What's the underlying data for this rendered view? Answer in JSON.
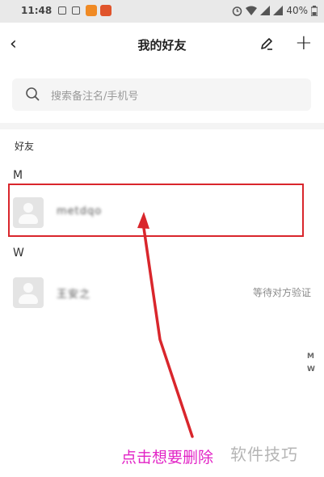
{
  "status_bar": {
    "time": "11:48",
    "battery": "40%"
  },
  "nav": {
    "title": "我的好友"
  },
  "search": {
    "placeholder": "搜索备注名/手机号"
  },
  "section_label": "好友",
  "groups": [
    {
      "letter": "M",
      "friends": [
        {
          "name": "metdqo",
          "status": ""
        }
      ]
    },
    {
      "letter": "W",
      "friends": [
        {
          "name": "王安之",
          "status": "等待对方验证"
        }
      ]
    }
  ],
  "side_index": [
    "M",
    "W"
  ],
  "annotation": {
    "caption": "点击想要删除",
    "color": "#e223c6",
    "box_color": "#d9262c"
  },
  "watermark": "软件技巧"
}
